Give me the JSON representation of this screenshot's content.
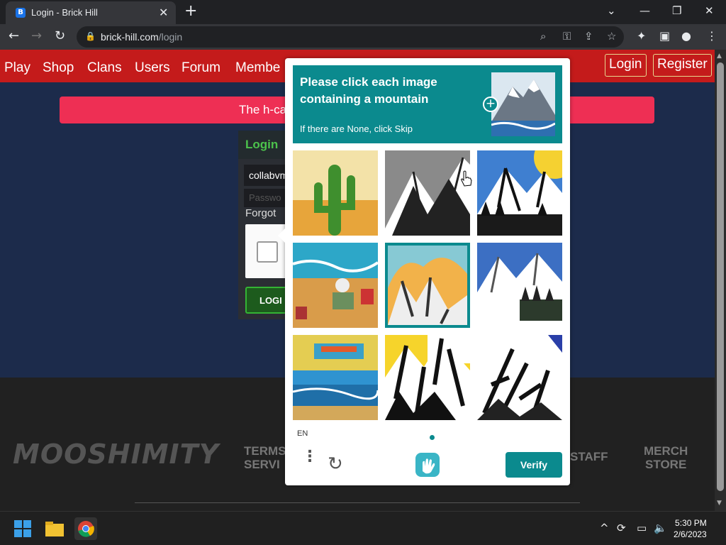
{
  "browser": {
    "tab_title": "Login - Brick Hill",
    "favicon_letter": "B",
    "new_tab": "+",
    "close_tab": "✕",
    "url_domain": "brick-hill.com",
    "url_path": "/login",
    "minimize": "—",
    "restore": "❐",
    "close": "✕",
    "dropdown": "⌄"
  },
  "site": {
    "nav": [
      "Play",
      "Shop",
      "Clans",
      "Users",
      "Forum",
      "Membe"
    ],
    "login_button": "Login",
    "register_button": "Register",
    "alert_text": "The h-ca",
    "login_panel": {
      "heading": "Login",
      "username_value": "collabvm",
      "password_placeholder": "Passwo",
      "forgot_text": "Forgot",
      "submit_label": "LOGI"
    },
    "footer": {
      "logo_text": "MOOSHIMITY",
      "terms": "TERMS\nSERVI",
      "staff": "STAFF",
      "merch": "MERCH\nSTORE"
    }
  },
  "hcaptcha": {
    "prompt": "Please click each image containing a mountain",
    "subtext": "If there are None, click Skip",
    "language": "EN",
    "verify_label": "Verify",
    "tiles": [
      {
        "subject": "cactus-desert",
        "selected": false
      },
      {
        "subject": "mountain-gray",
        "selected": false
      },
      {
        "subject": "mountain-sun-blue",
        "selected": false
      },
      {
        "subject": "beach-scene",
        "selected": false
      },
      {
        "subject": "mountain-sunset",
        "selected": true
      },
      {
        "subject": "mountain-snow-forest",
        "selected": false
      },
      {
        "subject": "beach-sign",
        "selected": false
      },
      {
        "subject": "mountain-bw-yellow",
        "selected": false
      },
      {
        "subject": "mountain-bw-blue",
        "selected": false
      }
    ]
  },
  "taskbar": {
    "time": "5:30 PM",
    "date": "2/6/2023"
  },
  "colors": {
    "site_nav": "#c41b1b",
    "alert": "#ee2f54",
    "hcaptcha_teal": "#0b8a8e",
    "page_bg": "#1c2b4b"
  }
}
